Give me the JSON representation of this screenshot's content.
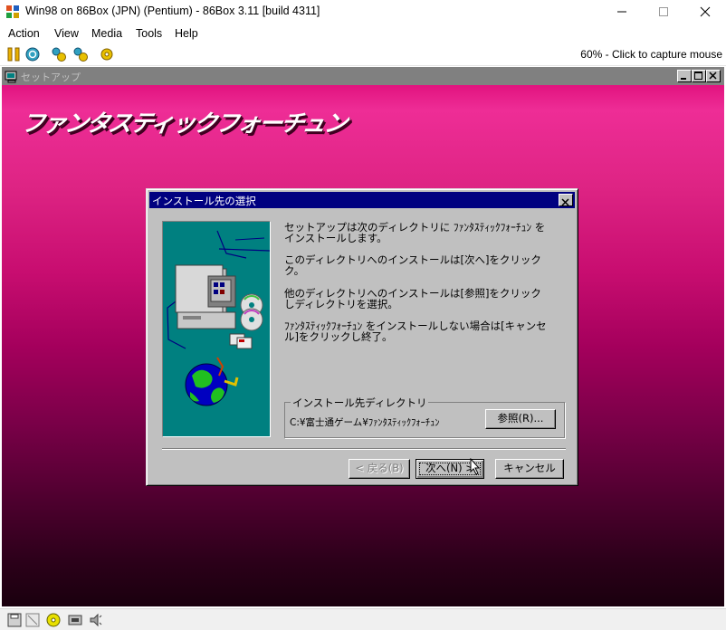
{
  "host": {
    "title": "Win98 on 86Box (JPN) (Pentium) - 86Box 3.11 [build 4311]",
    "menu": [
      "Action",
      "View",
      "Media",
      "Tools",
      "Help"
    ],
    "capture_text": "60% - Click to capture mouse",
    "toolbar_icons": [
      "pause-icon",
      "reset-icon",
      "ctrl-alt-del-icon",
      "ctrl-alt-esc-icon",
      "settings-icon"
    ],
    "status_icons": [
      "floppy-icon",
      "floppy-empty-icon",
      "cdrom-icon",
      "network-icon",
      "sound-icon"
    ]
  },
  "guest": {
    "setup_window_title": "セットアップ",
    "product_logo": "ファンタスティックフォーチュン",
    "dialog": {
      "title": "インストール先の選択",
      "messages": [
        "セットアップは次のディレクトリに ﾌｧﾝﾀｽﾃｨｯｸﾌｫｰﾁｭﾝ を\nインストールします。",
        "このディレクトリへのインストールは[次へ]をクリック\nク。",
        "他のディレクトリへのインストールは[参照]をクリック\nしディレクトリを選択。",
        "ﾌｧﾝﾀｽﾃｨｯｸﾌｫｰﾁｭﾝ をインストールしない場合は[キャンセ\nル]をクリックし終了。"
      ],
      "group_label": "インストール先ディレクトリ",
      "install_path": "C:¥富士通ゲーム¥ﾌｧﾝﾀｽﾃｨｯｸﾌｫｰﾁｭﾝ",
      "browse_button": "参照(R)...",
      "back_button": "< 戻る(B)",
      "next_button": "次へ(N) >",
      "cancel_button": "キャンセル"
    }
  },
  "colors": {
    "dialog_title_bg": "#000080",
    "win_face": "#c0c0c0",
    "illustration_bg": "#008080",
    "guest_top": "#d8006e",
    "guest_bottom": "#1a000e"
  }
}
